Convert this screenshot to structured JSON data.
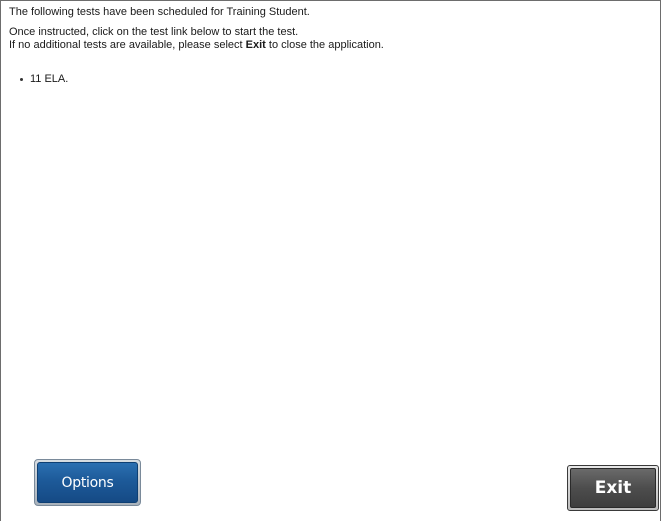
{
  "intro": {
    "scheduled_text": "The following tests have been scheduled for Training Student."
  },
  "instructions": {
    "line1": "Once instructed, click on the test link below to start the test.",
    "line2_before": "If no additional tests are available, please select ",
    "line2_bold": "Exit",
    "line2_after": " to close the application."
  },
  "tests": [
    {
      "label": "11 ELA."
    }
  ],
  "buttons": {
    "options_label": "Options",
    "exit_label": "Exit"
  },
  "colors": {
    "options_button": "#1d5a99",
    "exit_button": "#4d4d4d"
  }
}
